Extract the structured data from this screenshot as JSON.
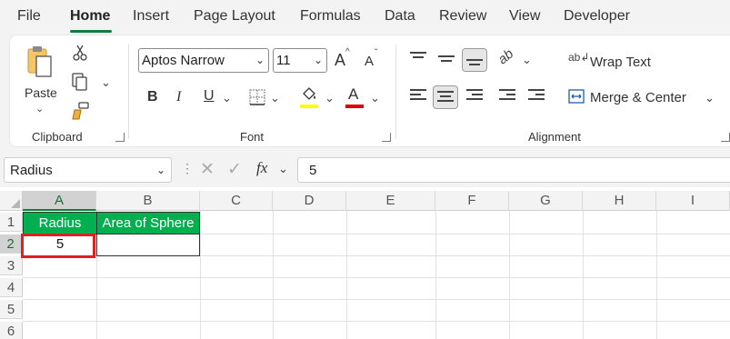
{
  "menu": {
    "tabs": [
      "File",
      "Home",
      "Insert",
      "Page Layout",
      "Formulas",
      "Data",
      "Review",
      "View",
      "Developer"
    ],
    "active": "Home"
  },
  "ribbon": {
    "clipboard": {
      "paste_label": "Paste",
      "group_label": "Clipboard"
    },
    "font": {
      "font_name": "Aptos Narrow",
      "font_size": "11",
      "grow_label": "A",
      "shrink_label": "A",
      "bold": "B",
      "italic": "I",
      "underline": "U",
      "font_color_letter": "A",
      "group_label": "Font",
      "highlight_color": "#ffff00",
      "font_color": "#e00000"
    },
    "alignment": {
      "wrap_text": "Wrap Text",
      "merge_center": "Merge & Center",
      "group_label": "Alignment"
    }
  },
  "formula_bar": {
    "name_box": "Radius",
    "fx": "fx",
    "value": "5"
  },
  "grid": {
    "columns": [
      "A",
      "B",
      "C",
      "D",
      "E",
      "F",
      "G",
      "H",
      "I"
    ],
    "rows": [
      "1",
      "2",
      "3",
      "4",
      "5",
      "6"
    ],
    "selected_column": "A",
    "selected_row": "2",
    "cells": {
      "A1": "Radius",
      "B1": "Area of Sphere",
      "A2": "5"
    },
    "header_fill": "#00b050",
    "highlight_border": "#e02020"
  }
}
